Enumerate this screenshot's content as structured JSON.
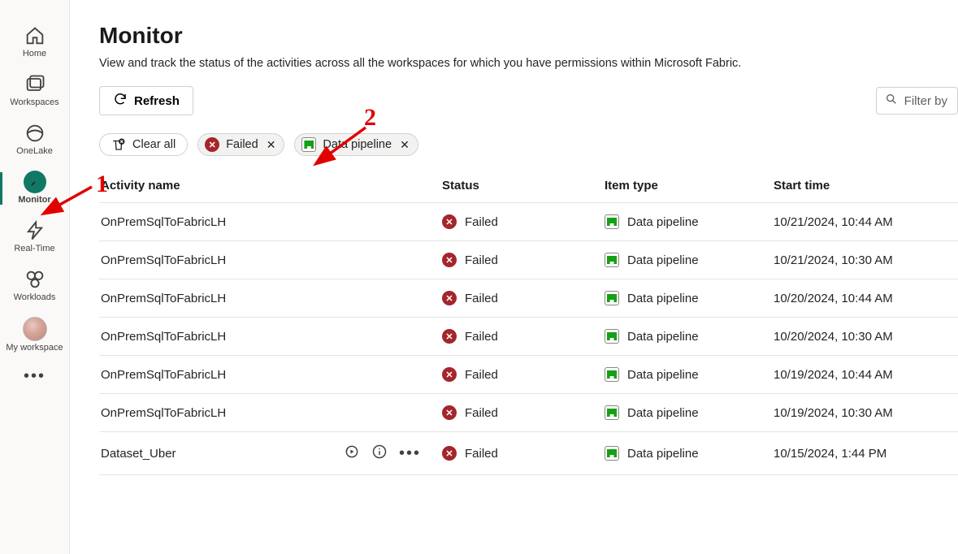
{
  "sidebar": {
    "items": [
      {
        "id": "home",
        "label": "Home"
      },
      {
        "id": "workspaces",
        "label": "Workspaces"
      },
      {
        "id": "onelake",
        "label": "OneLake"
      },
      {
        "id": "monitor",
        "label": "Monitor"
      },
      {
        "id": "realtime",
        "label": "Real-Time"
      },
      {
        "id": "workloads",
        "label": "Workloads"
      },
      {
        "id": "myworkspace",
        "label": "My workspace"
      }
    ]
  },
  "header": {
    "title": "Monitor",
    "subtitle": "View and track the status of the activities across all the workspaces for which you have permissions within Microsoft Fabric."
  },
  "toolbar": {
    "refresh_label": "Refresh",
    "search_placeholder": "Filter by"
  },
  "filters": {
    "clear_all_label": "Clear all",
    "chips": [
      {
        "id": "failed",
        "label": "Failed"
      },
      {
        "id": "data-pipeline",
        "label": "Data pipeline"
      }
    ]
  },
  "table": {
    "columns": {
      "activity_name": "Activity name",
      "status": "Status",
      "item_type": "Item type",
      "start_time": "Start time"
    },
    "rows": [
      {
        "name": "OnPremSqlToFabricLH",
        "status": "Failed",
        "type": "Data pipeline",
        "time": "10/21/2024, 10:44 AM",
        "actions": false
      },
      {
        "name": "OnPremSqlToFabricLH",
        "status": "Failed",
        "type": "Data pipeline",
        "time": "10/21/2024, 10:30 AM",
        "actions": false
      },
      {
        "name": "OnPremSqlToFabricLH",
        "status": "Failed",
        "type": "Data pipeline",
        "time": "10/20/2024, 10:44 AM",
        "actions": false
      },
      {
        "name": "OnPremSqlToFabricLH",
        "status": "Failed",
        "type": "Data pipeline",
        "time": "10/20/2024, 10:30 AM",
        "actions": false
      },
      {
        "name": "OnPremSqlToFabricLH",
        "status": "Failed",
        "type": "Data pipeline",
        "time": "10/19/2024, 10:44 AM",
        "actions": false
      },
      {
        "name": "OnPremSqlToFabricLH",
        "status": "Failed",
        "type": "Data pipeline",
        "time": "10/19/2024, 10:30 AM",
        "actions": false
      },
      {
        "name": "Dataset_Uber",
        "status": "Failed",
        "type": "Data pipeline",
        "time": "10/15/2024, 1:44 PM",
        "actions": true
      }
    ]
  },
  "annotations": {
    "num1": "1",
    "num2": "2"
  },
  "colors": {
    "accent": "#117865",
    "failed": "#a4262c",
    "annotation": "#e10000"
  }
}
